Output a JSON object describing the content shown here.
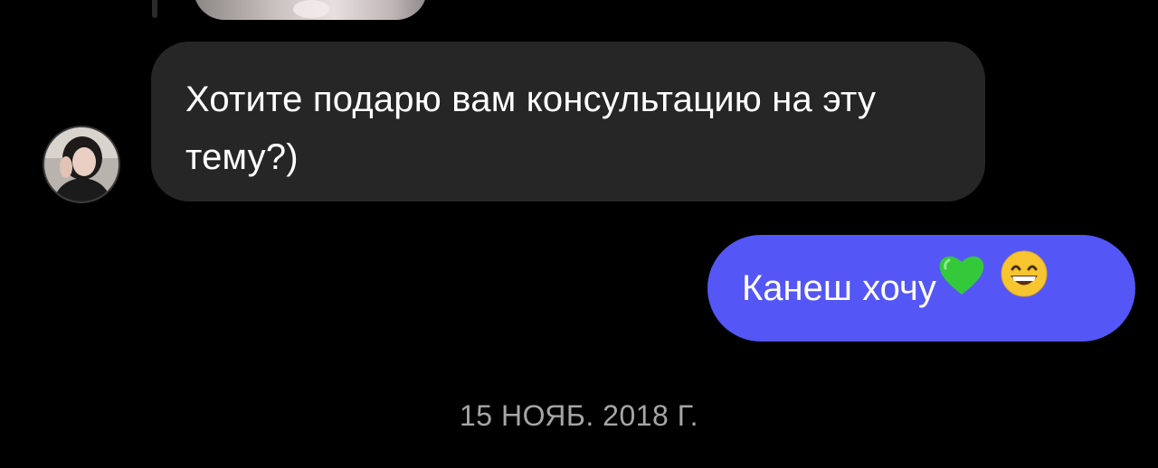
{
  "conversation": {
    "messages": [
      {
        "direction": "incoming",
        "text": "Хотите подарю вам консультацию на эту тему?)"
      },
      {
        "direction": "outgoing",
        "text": "Канеш хочу",
        "emojis": [
          "green-heart-emoji",
          "grinning-smiling-eyes-emoji"
        ]
      }
    ],
    "date_separator": "15 НОЯБ. 2018 Г."
  },
  "colors": {
    "background": "#000000",
    "incoming_bubble": "#262626",
    "outgoing_bubble": "#5457f5",
    "text": "#ffffff",
    "date_text": "#a6a6a6"
  }
}
